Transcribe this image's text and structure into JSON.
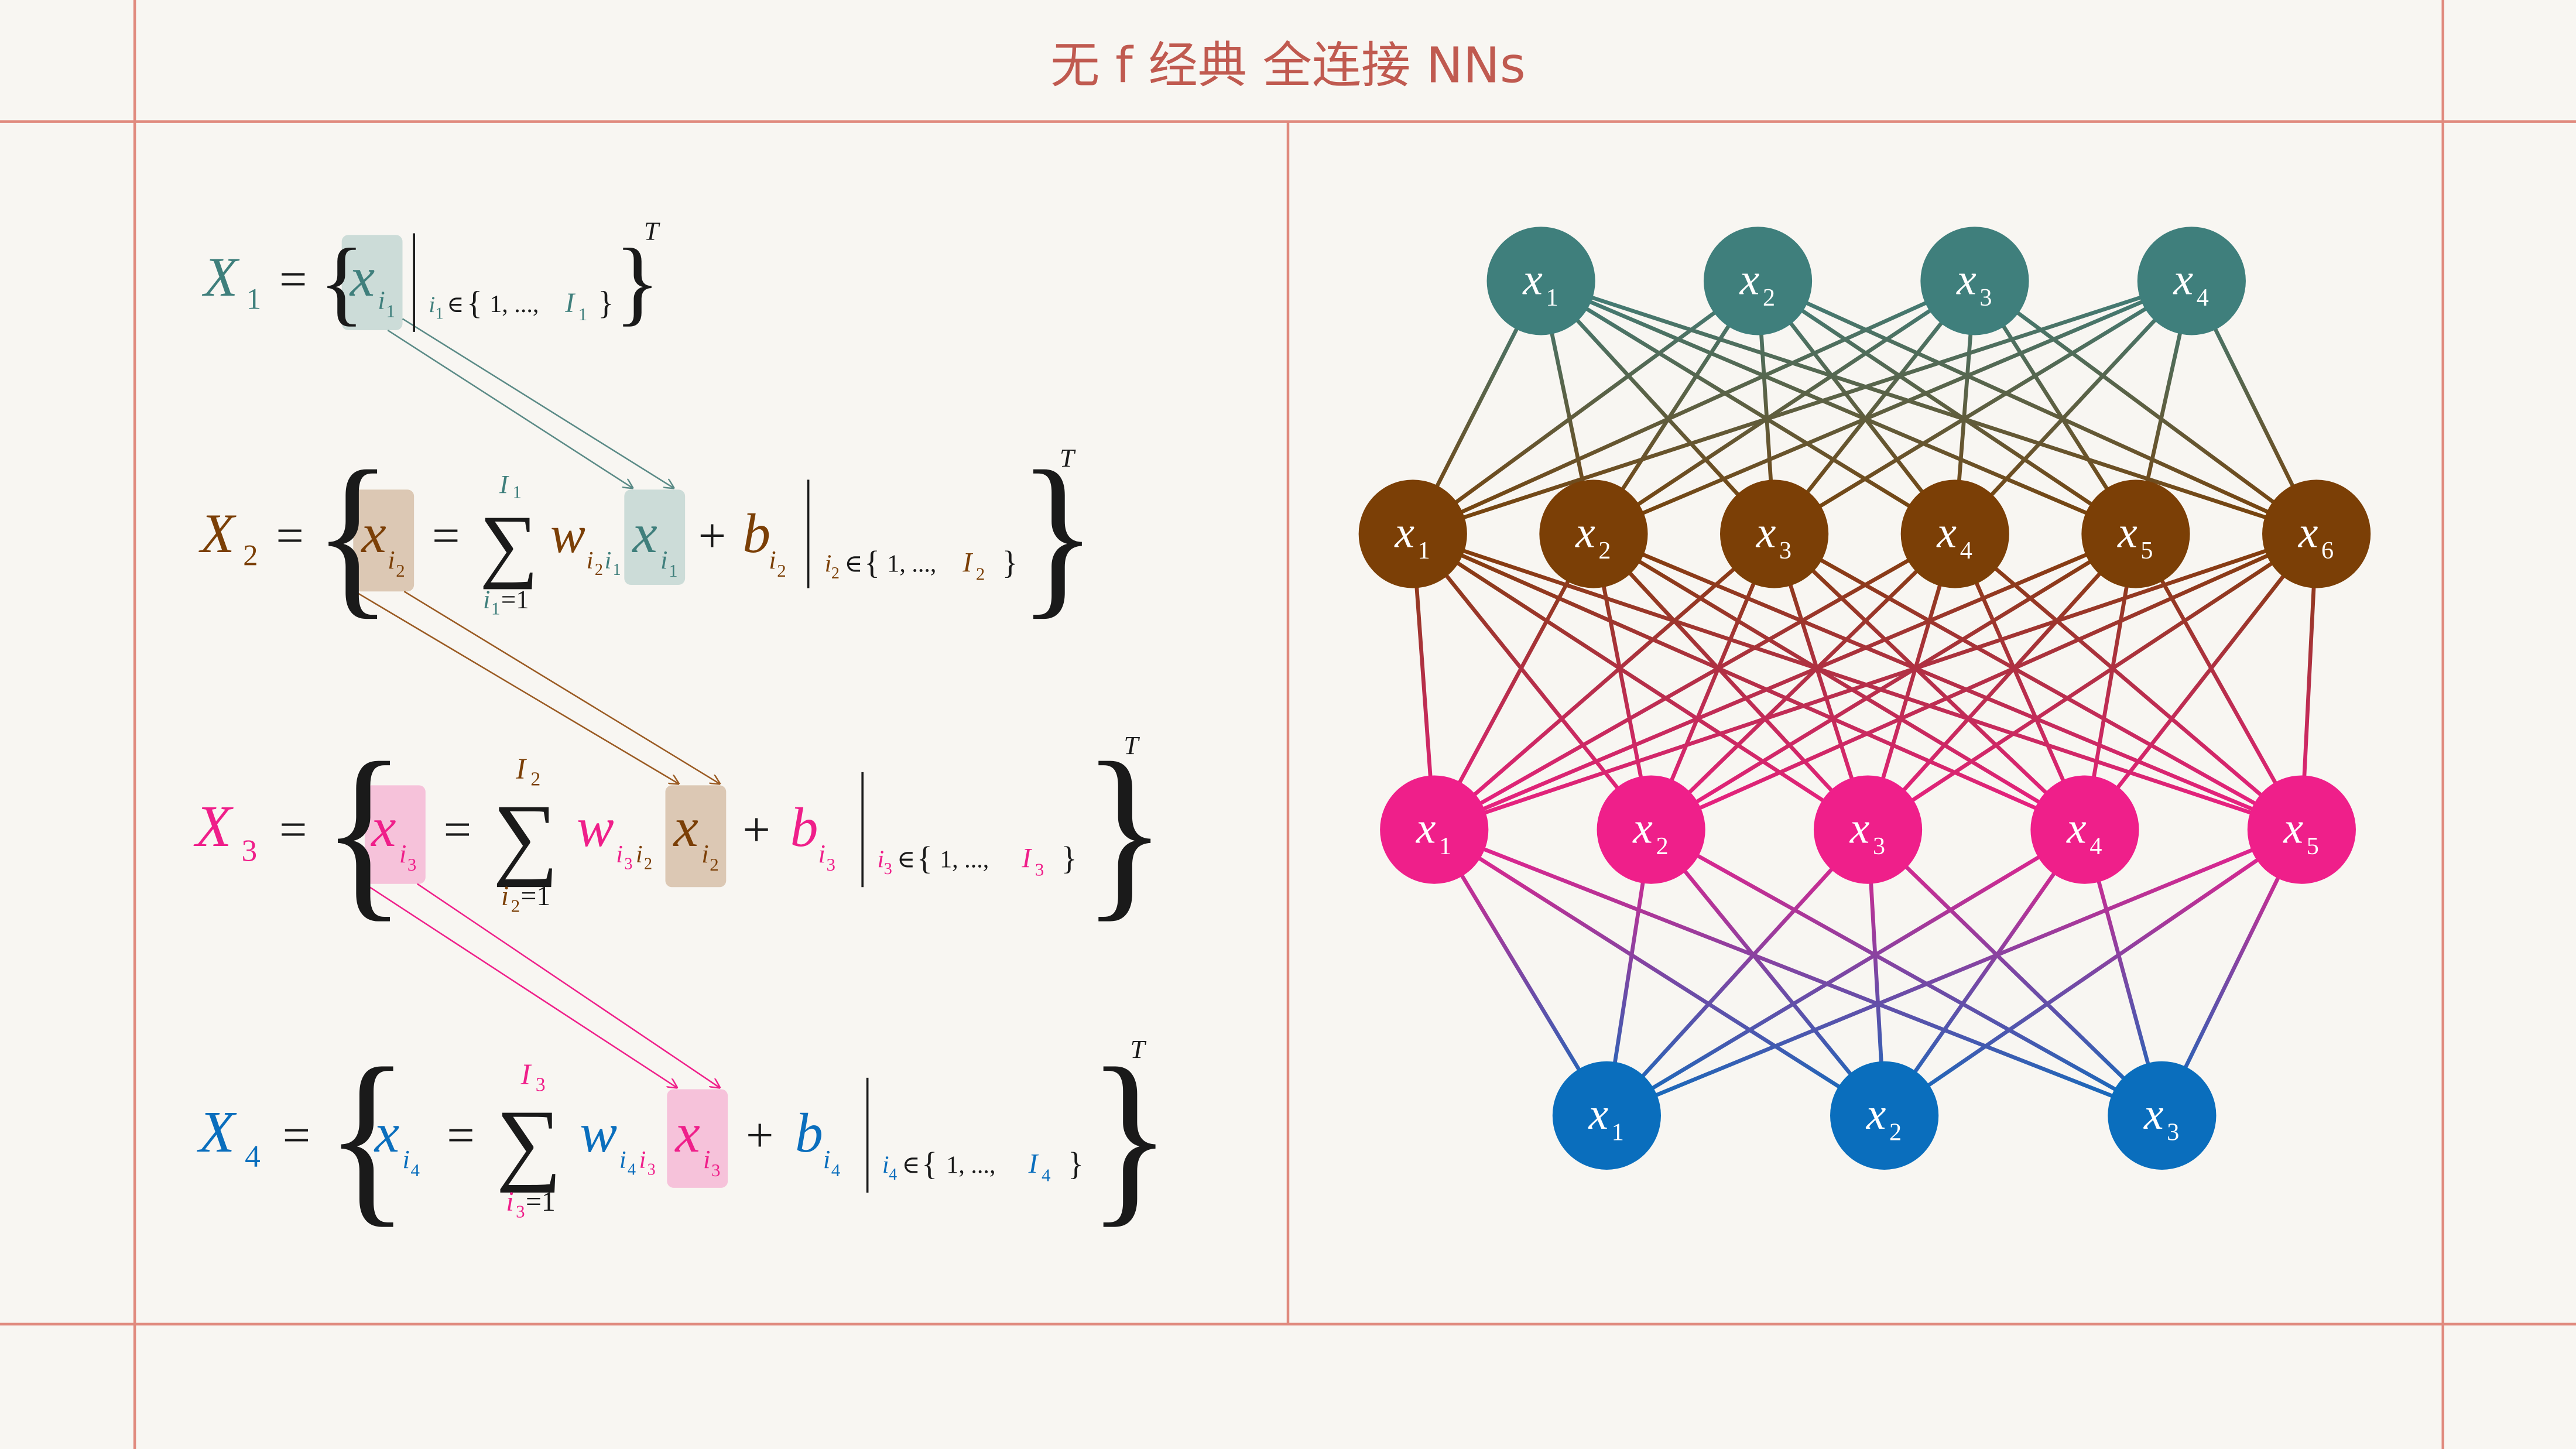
{
  "title": "无 f 经典 全连接 NNs",
  "colors": {
    "frame": "#e08a7e",
    "title": "#c05a50",
    "layer1": "#3f7f7c",
    "layer2": "#7b3f06",
    "layer3": "#ef1f8a",
    "layer4": "#0a6ebd",
    "layer1_box": "#ccdcd8",
    "layer2_box": "#dcc8b4",
    "layer3_box": "#f6c2da",
    "black": "#1a1a1a",
    "node_text": "#ffffff"
  },
  "equations": {
    "X1": {
      "lhs": "X",
      "lhs_sub": "1",
      "T": "T"
    },
    "X2": {
      "lhs": "X",
      "lhs_sub": "2",
      "T": "T"
    },
    "X3": {
      "lhs": "X",
      "lhs_sub": "3",
      "T": "T"
    },
    "X4": {
      "lhs": "X",
      "lhs_sub": "4",
      "T": "T"
    },
    "eq_sign": "=",
    "plus": "+",
    "sum": "∑",
    "set_open": "{",
    "set_close": "}",
    "in": "∈",
    "range_mid": "1, ...,",
    "x": "x",
    "i": "i",
    "w": "w",
    "b": "b",
    "I": "I",
    "idx1": "1",
    "idx2": "2",
    "idx3": "3",
    "idx4": "4",
    "sum_lower_eq": "=1"
  },
  "network": {
    "layers": [
      {
        "node_label": "x",
        "subs": [
          "1",
          "2",
          "3",
          "4"
        ]
      },
      {
        "node_label": "x",
        "subs": [
          "1",
          "2",
          "3",
          "4",
          "5",
          "6"
        ]
      },
      {
        "node_label": "x",
        "subs": [
          "1",
          "2",
          "3",
          "4",
          "5"
        ]
      },
      {
        "node_label": "x",
        "subs": [
          "1",
          "2",
          "3"
        ]
      }
    ]
  }
}
